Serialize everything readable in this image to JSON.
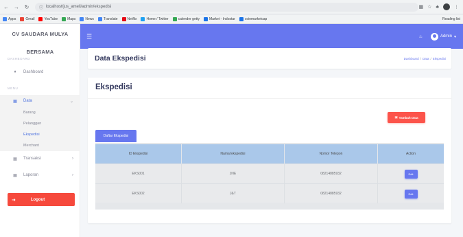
{
  "browser": {
    "url": "localhost/jus_ameli/admin/ekspedisi",
    "bookmarks": [
      "Apps",
      "Gmail",
      "YouTube",
      "Maps",
      "News",
      "Translate",
      "Netflix",
      "Home / Twitter",
      "calender getty",
      "Market - Indostar",
      "coinmarketcap"
    ],
    "reading_list": "Reading list"
  },
  "sidebar": {
    "brand_line1": "CV SAUDARA MULYA",
    "brand_line2": "BERSAMA",
    "heading_dashboard": "DASHBOARD",
    "dashboard_label": "Dashboard",
    "heading_menu": "MENU",
    "data_label": "Data",
    "data_sub": [
      "Barang",
      "Pelanggan",
      "Ekspedisi",
      "Merchant"
    ],
    "transaksi_label": "Transaksi",
    "laporan_label": "Laporan",
    "logout_label": "Logout"
  },
  "topbar": {
    "user_label": "Admin"
  },
  "header": {
    "title": "Data Ekspedisi",
    "breadcrumb": [
      "Dashboard",
      "Data",
      "Ekspedisi"
    ]
  },
  "card": {
    "title": "Ekspedisi",
    "add_button": "Tambah Data",
    "tab_label": "Daftar Ekspedisi",
    "columns": [
      "ID Ekspedisi",
      "Nama Ekspedisi",
      "Nomor Telepon",
      "Action"
    ],
    "rows": [
      {
        "id": "EKS001",
        "name": "JNE",
        "phone": "08214885932",
        "action": "Edit"
      },
      {
        "id": "EKS002",
        "name": "J&T",
        "phone": "08214885932",
        "action": "Edit"
      }
    ]
  },
  "colors": {
    "primary": "#6777ef",
    "danger": "#fc544b",
    "table_header": "#aac8ea"
  }
}
